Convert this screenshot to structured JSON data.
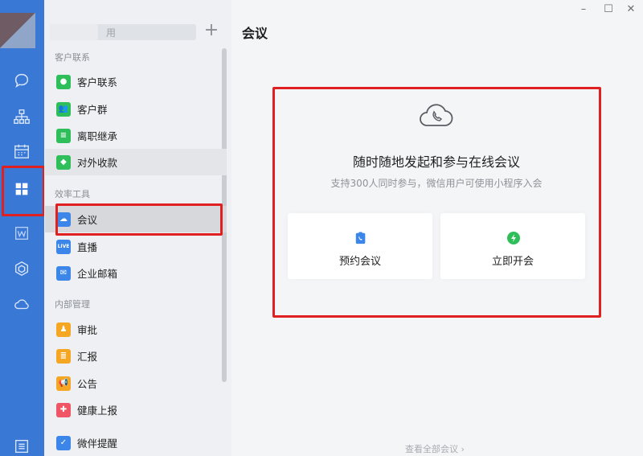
{
  "window": {
    "title": "会议",
    "controls": {
      "minimize": "–",
      "maximize": "☐",
      "close": "✕"
    }
  },
  "rail": {
    "icons": [
      "chat-icon",
      "org-chart-icon",
      "calendar-icon",
      "workbench-grid-icon",
      "doc-w-icon",
      "cube-icon",
      "cloud-phone-icon",
      "settings-menu-icon"
    ],
    "highlighted": "workbench-grid-icon"
  },
  "search": {
    "placeholder": "用"
  },
  "sections": [
    {
      "title": "客户联系",
      "items": [
        {
          "label": "客户联系",
          "icon": "customer-contact-icon",
          "color": "#2fbf5a"
        },
        {
          "label": "客户群",
          "icon": "customer-group-icon",
          "color": "#2fbf5a"
        },
        {
          "label": "离职继承",
          "icon": "resign-inherit-icon",
          "color": "#2fbf5a"
        },
        {
          "label": "对外收款",
          "icon": "payment-icon",
          "color": "#2fbf5a"
        }
      ]
    },
    {
      "title": "效率工具",
      "items": [
        {
          "label": "会议",
          "icon": "meeting-cloud-icon",
          "color": "#3b86e8"
        },
        {
          "label": "直播",
          "icon": "live-icon",
          "color": "#3b86e8",
          "text": "LIVE"
        },
        {
          "label": "企业邮箱",
          "icon": "mail-icon",
          "color": "#3b86e8"
        }
      ]
    },
    {
      "title": "内部管理",
      "items": [
        {
          "label": "审批",
          "icon": "approval-icon",
          "color": "#f5a623"
        },
        {
          "label": "汇报",
          "icon": "report-icon",
          "color": "#f5a623"
        },
        {
          "label": "公告",
          "icon": "announcement-icon",
          "color": "#f5a623"
        },
        {
          "label": "健康上报",
          "icon": "health-report-icon",
          "color": "#f05565"
        },
        {
          "label": "微伴提醒",
          "icon": "reminder-icon",
          "color": "#3b86e8"
        }
      ]
    }
  ],
  "main": {
    "title": "随时随地发起和参与在线会议",
    "subtitle": "支持300人同时参与，微信用户可使用小程序入会",
    "actions": [
      {
        "label": "预约会议",
        "icon": "schedule-meeting-icon",
        "color": "#3b86e8"
      },
      {
        "label": "立即开会",
        "icon": "start-now-icon",
        "color": "#2fbf5a"
      }
    ],
    "view_all": "查看全部会议 ›"
  }
}
